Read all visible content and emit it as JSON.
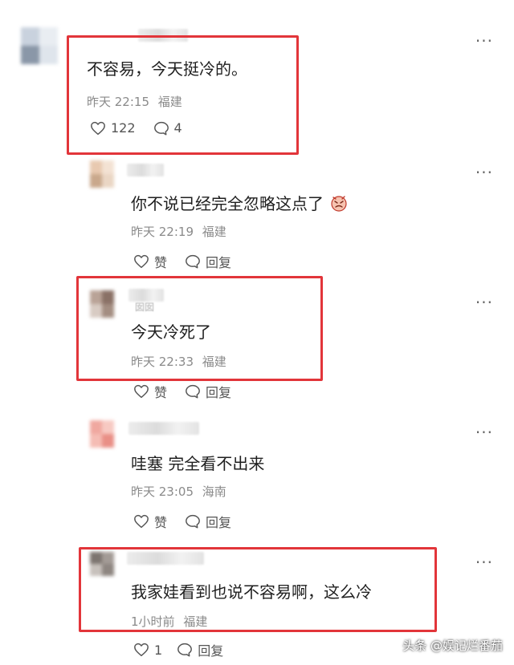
{
  "comments": [
    {
      "text": "不容易，今天挺冷的。",
      "time": "昨天 22:15",
      "location": "福建",
      "likes": "122",
      "replies": "4"
    },
    {
      "text": "你不说已经完全忽略这点了",
      "emoji": "face-icon",
      "time": "昨天 22:19",
      "location": "福建",
      "like_label": "赞",
      "reply_label": "回复"
    },
    {
      "username_fragment": "囡囡",
      "text": "今天冷死了",
      "time": "昨天 22:33",
      "location": "福建",
      "like_label": "赞",
      "reply_label": "回复"
    },
    {
      "text": "哇塞 完全看不出来",
      "time": "昨天 23:05",
      "location": "海南",
      "like_label": "赞",
      "reply_label": "回复"
    },
    {
      "text": "我家娃看到也说不容易啊，这么冷",
      "time": "1小时前",
      "location": "福建",
      "likes": "1",
      "reply_label": "回复"
    }
  ],
  "more_glyph": "···",
  "watermark": "头条 @娱记烂番茄",
  "colors": {
    "highlight": "#e2353a",
    "meta": "#8a8a8a"
  }
}
